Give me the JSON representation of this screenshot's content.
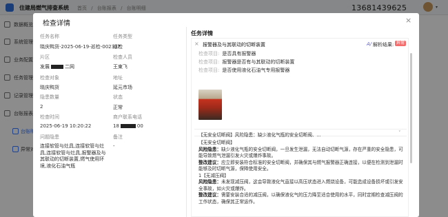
{
  "app": {
    "title": "住建局燃气排查系统",
    "crumbs": [
      "首页",
      "/",
      "台账报表",
      "/",
      "台账明细"
    ],
    "phone": "13681439625",
    "avatar_caret": "▾"
  },
  "sidebar": {
    "items": [
      {
        "label": "数据概览"
      },
      {
        "label": "系统管理"
      },
      {
        "label": "业务配置"
      },
      {
        "label": "任务管理"
      },
      {
        "label": "记录管理"
      },
      {
        "label": "台账报表"
      },
      {
        "label": "台账明细"
      },
      {
        "label": "异常对"
      }
    ]
  },
  "modal": {
    "title": "检查详情",
    "close": "×",
    "fields": {
      "task_name_label": "任务名称",
      "task_name": "晓庆鸭货-2025-06-19-巡检-002337",
      "task_type_label": "任务类型",
      "task_type": "巡检",
      "area_label": "片区",
      "area_prefix": "发展",
      "area_suffix": "二网",
      "inspector_label": "检查人员",
      "inspector": "王東飞",
      "target_label": "检查对象",
      "target": "晓庆鸭货",
      "address_label": "地址",
      "address": "延元市场",
      "hazard_count_label": "隐患数量",
      "hazard_count": "2",
      "status_label": "状态",
      "status": "正常",
      "check_time_label": "检查时间",
      "check_time": "2025-06-19 10:20:22",
      "merchant_phone_label": "商户联系电话",
      "merchant_phone_prefix": "18",
      "merchant_phone_suffix": "00",
      "hazard_desc_label": "问题隐患",
      "hazard_desc": "连接软管与灶具,连接软管与灶具,连接软管与灶具,报警器及与其联动的切断装置,燃气使用环境,液化石油气瓶",
      "remark_label": "备注",
      "remark": "-"
    }
  },
  "task": {
    "title": "任务详情",
    "item": {
      "close": "×",
      "title": "报警器及与其联动的切断装置",
      "ai_icon": "A/",
      "ai_label": "解析结果:",
      "badge": "异常",
      "chevron": "˄",
      "checks": [
        {
          "k": "检查项目:",
          "v": "是否具有报警器"
        },
        {
          "k": "检查项目:",
          "v": "报警器是否有与其联动的切断装置"
        },
        {
          "k": "检查项目:",
          "v": "是否使用液化石油气专用报警器"
        }
      ]
    },
    "summary": {
      "text": "【无安全切断阀】风险隐患：缺少液化气瓶的安全切断阀、...",
      "chevron": "˅"
    },
    "analysis": {
      "heading1": "【无安全切断阀】",
      "risk1_label": "风险隐患：",
      "risk1": "缺少液化气瓶的安全切断阀，一旦发生泄漏，无法自动切断气源，存在严重的安全隐患，可能导致燃气泄漏引发火灾或爆炸事故。",
      "fix1_label": "整改建议：",
      "fix1": "应立即安装符合标准的安全切断阀，并确保其与燃气报警器正确连接，以便在检测到泄漏时能够及时切断气源，保障使用安全。",
      "heading2": "1【无减压阀】",
      "risk2_label": "风险隐患：",
      "risk2": "未发现减压阀，这会导致液化气直接以高压状态进入燃烧设备，可能造成设备损坏或引发安全事故，如火灾或爆炸。",
      "fix2_label": "整改建议：",
      "fix2": "需要安装合适的减压阀，以确保液化气的压力降至适合使用的水平，同时定期检查减压阀的工作状态，确保其正常运作。"
    }
  },
  "colors": {
    "accent": "#3a78ff",
    "danger": "#f56c6c",
    "overlay": "rgba(0,0,0,0.45)"
  }
}
